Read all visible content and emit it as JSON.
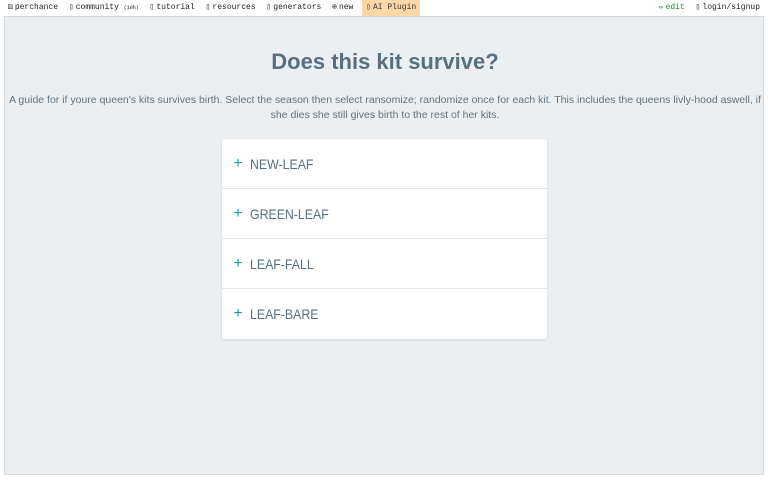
{
  "topbar": {
    "left": [
      {
        "icon": "dice-icon",
        "glyph": "⚄",
        "label": "perchance"
      },
      {
        "icon": "chat-icon",
        "glyph": "▯",
        "label": "community",
        "badge": "(10h)"
      },
      {
        "icon": "book-icon",
        "glyph": "▯",
        "label": "tutorial"
      },
      {
        "icon": "folder-icon",
        "glyph": "▯",
        "label": "resources"
      },
      {
        "icon": "list-icon",
        "glyph": "▯",
        "label": "generators"
      },
      {
        "icon": "plus-circle-icon",
        "glyph": "⊕",
        "label": "new"
      },
      {
        "icon": "robot-icon",
        "glyph": "▯",
        "label": "AI Plugin"
      }
    ],
    "right": [
      {
        "icon": "pencil-icon",
        "glyph": "✏",
        "label": "edit"
      },
      {
        "icon": "user-icon",
        "glyph": "▯",
        "label": "login/signup"
      }
    ]
  },
  "main": {
    "title": "Does this kit survive?",
    "description": "A guide for if youre queen's kits survives birth. Select the season then select ransomize; randomize once for each kit. This includes the queens livly-hood aswell, if she dies she still gives birth to the rest of her kits."
  },
  "accordion": {
    "expand_glyph": "+",
    "items": [
      {
        "label": "NEW-LEAF"
      },
      {
        "label": "GREEN-LEAF"
      },
      {
        "label": "LEAF-FALL"
      },
      {
        "label": "LEAF-BARE"
      }
    ]
  },
  "colors": {
    "accent": "#1aa0a0",
    "title": "#56707f",
    "background": "#eceff1",
    "ai_plugin_highlight": "#fdd7a6",
    "edit_link": "#2c8a2c"
  }
}
